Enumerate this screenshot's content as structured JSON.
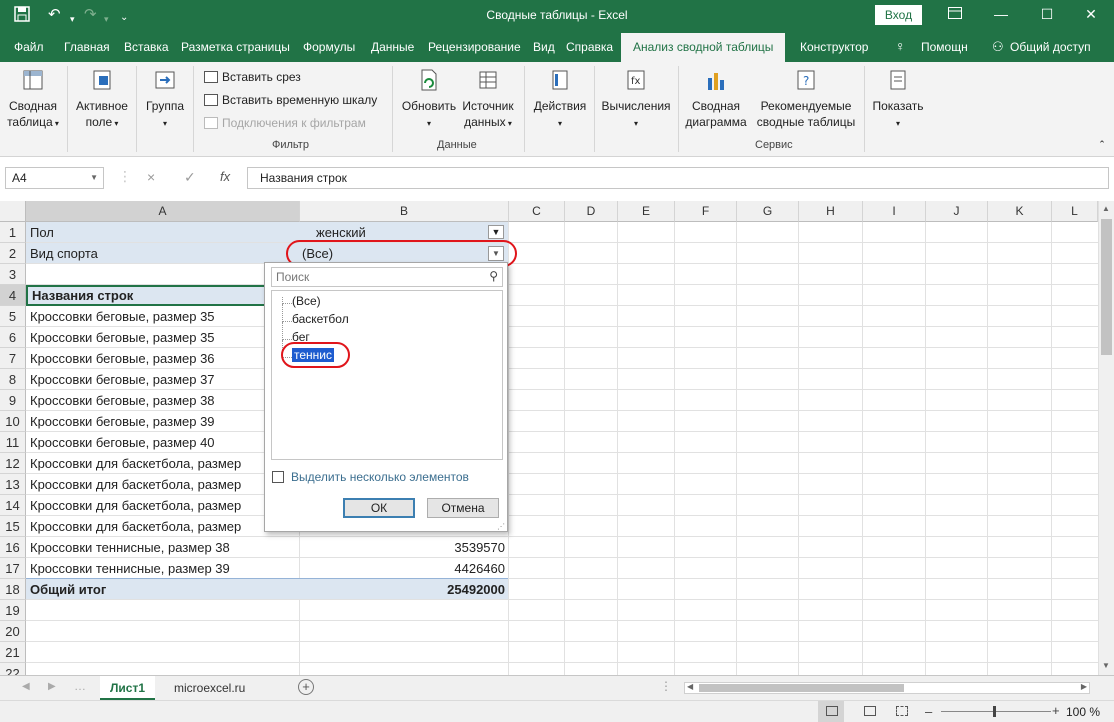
{
  "titlebar": {
    "save_icon": "save-icon",
    "undo_icon": "undo-icon",
    "redo_icon": "redo-icon",
    "title": "Сводные таблицы  -  Excel",
    "login_label": "Вход",
    "ribbon_display_icon": "ribbon-display-icon",
    "minimize_icon": "minimize-icon",
    "maximize_icon": "maximize-icon",
    "close_icon": "close-icon"
  },
  "tabs": [
    "Файл",
    "Главная",
    "Вставка",
    "Разметка страницы",
    "Формулы",
    "Данные",
    "Рецензирование",
    "Вид",
    "Справка",
    "Анализ сводной таблицы",
    "Конструктор",
    "Помощн",
    "Общий доступ"
  ],
  "ribbon": {
    "pivot_table": "Сводная\nтаблица",
    "active_field": "Активное\nполе",
    "group": "Группа",
    "insert_slicer": "Вставить срез",
    "insert_timeline": "Вставить временную шкалу",
    "filter_connections": "Подключения к фильтрам",
    "filter_group": "Фильтр",
    "refresh": "Обновить",
    "data_source": "Источник\nданных",
    "data_group": "Данные",
    "actions": "Действия",
    "calculations": "Вычисления",
    "pivot_chart": "Сводная\nдиаграмма",
    "recommended": "Рекомендуемые\nсводные таблицы",
    "service_group": "Сервис",
    "show": "Показать"
  },
  "formula_bar": {
    "name_box": "A4",
    "cancel_icon": "×",
    "enter_icon": "✓",
    "fx": "fx",
    "formula": "Названия строк"
  },
  "columns": [
    "A",
    "B",
    "C",
    "D",
    "E",
    "F",
    "G",
    "H",
    "I",
    "J",
    "K",
    "L"
  ],
  "rows": [
    {
      "n": "1",
      "a": "Пол",
      "b": "женский"
    },
    {
      "n": "2",
      "a": "Вид спорта",
      "b": "(Все)"
    },
    {
      "n": "3",
      "a": "",
      "b": ""
    },
    {
      "n": "4",
      "a": "Названия строк",
      "b": ""
    },
    {
      "n": "5",
      "a": "Кроссовки беговые, размер 35",
      "b": ""
    },
    {
      "n": "6",
      "a": "Кроссовки беговые, размер 35",
      "b": ""
    },
    {
      "n": "7",
      "a": "Кроссовки беговые, размер 36",
      "b": ""
    },
    {
      "n": "8",
      "a": "Кроссовки беговые, размер 37",
      "b": ""
    },
    {
      "n": "9",
      "a": "Кроссовки беговые, размер 38",
      "b": ""
    },
    {
      "n": "10",
      "a": "Кроссовки беговые, размер 39",
      "b": ""
    },
    {
      "n": "11",
      "a": "Кроссовки беговые, размер 40",
      "b": ""
    },
    {
      "n": "12",
      "a": "Кроссовки для баскетбола, размер",
      "b": ""
    },
    {
      "n": "13",
      "a": "Кроссовки для баскетбола, размер",
      "b": ""
    },
    {
      "n": "14",
      "a": "Кроссовки для баскетбола, размер",
      "b": ""
    },
    {
      "n": "15",
      "a": "Кроссовки для баскетбола, размер",
      "b": ""
    },
    {
      "n": "16",
      "a": "Кроссовки теннисные, размер 38",
      "b": "3539570"
    },
    {
      "n": "17",
      "a": "Кроссовки теннисные, размер 39",
      "b": "4426460"
    },
    {
      "n": "18",
      "a": "Общий итог",
      "b": "25492000"
    },
    {
      "n": "19",
      "a": "",
      "b": ""
    },
    {
      "n": "20",
      "a": "",
      "b": ""
    },
    {
      "n": "21",
      "a": "",
      "b": ""
    },
    {
      "n": "22",
      "a": "",
      "b": ""
    }
  ],
  "filter_panel": {
    "search_placeholder": "Поиск",
    "items": [
      "(Все)",
      "баскетбол",
      "бег",
      "теннис"
    ],
    "selected_item": "теннис",
    "multi_select_label": "Выделить несколько элементов",
    "ok_label": "ОК",
    "cancel_label": "Отмена"
  },
  "sheets": {
    "tabs": [
      "Лист1",
      "microexcel.ru"
    ],
    "active": "Лист1"
  },
  "status": {
    "zoom": "100 %"
  },
  "colors": {
    "excel_green": "#217346",
    "pivot_band": "#dce6f1",
    "highlight_red": "#e0151b",
    "selection_blue": "#1e5ccf"
  }
}
